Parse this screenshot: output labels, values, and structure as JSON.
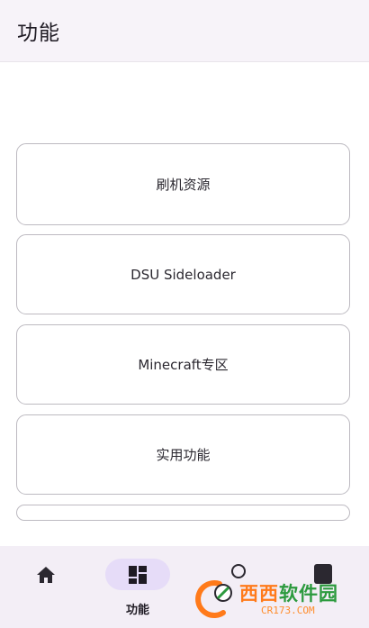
{
  "app_bar": {
    "title": "功能"
  },
  "menu": {
    "items": [
      {
        "label": "刷机资源"
      },
      {
        "label": "DSU Sideloader"
      },
      {
        "label": "Minecraft专区"
      },
      {
        "label": "实用功能"
      },
      {
        "label": ""
      }
    ]
  },
  "bottom_nav": {
    "items": [
      {
        "label": "",
        "icon": "home-icon"
      },
      {
        "label": "功能",
        "icon": "dashboard-icon",
        "selected": true
      },
      {
        "label": "",
        "icon": "partially-hidden-icon"
      },
      {
        "label": "",
        "icon": "phone-icon"
      }
    ]
  },
  "watermark": {
    "main": "西西软件园",
    "main_a": "西西",
    "main_b": "软件园",
    "sub": "CR173.COM"
  },
  "colors": {
    "app_bar_bg": "#f7f3f9",
    "nav_bg": "#f3eef6",
    "nav_selected_pill": "#e6dcf8",
    "card_border": "#bdbac1"
  }
}
